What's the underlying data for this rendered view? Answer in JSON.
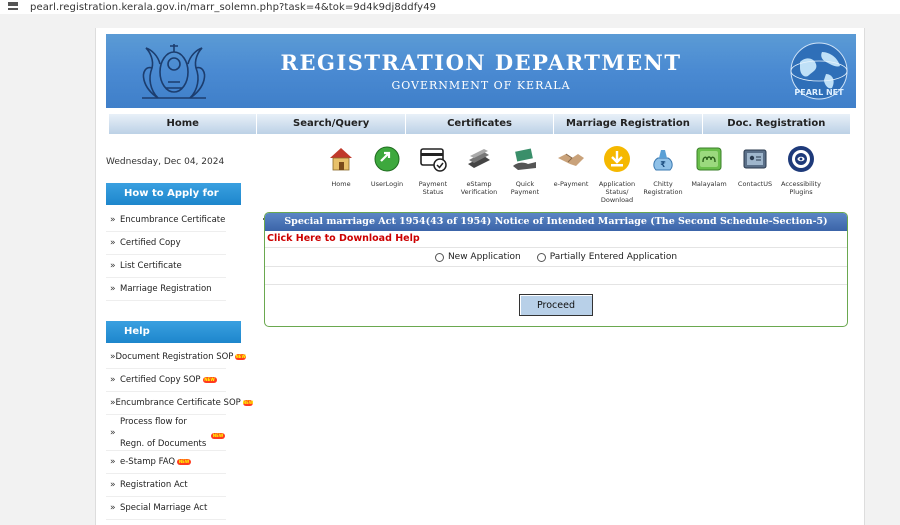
{
  "browser": {
    "url": "pearl.registration.kerala.gov.in/marr_solemn.php?task=4&tok=9d4k9dj8ddfy49"
  },
  "banner": {
    "title": "REGISTRATION DEPARTMENT",
    "subtitle": "GOVERNMENT OF KERALA",
    "globe_text": "PEARL NET"
  },
  "nav": [
    "Home",
    "Search/Query",
    "Certificates",
    "Marriage Registration",
    "Doc. Registration"
  ],
  "date": "Wednesday, Dec 04, 2024",
  "quick_icons": [
    {
      "label": "Home",
      "icon": "house-icon"
    },
    {
      "label": "UserLogin",
      "icon": "login-arrow-icon"
    },
    {
      "label": "Payment Status",
      "icon": "payment-status-icon"
    },
    {
      "label": "eStamp Verification",
      "icon": "estamp-icon"
    },
    {
      "label": "Quick Payment",
      "icon": "quick-payment-icon"
    },
    {
      "label": "e-Payment",
      "icon": "handshake-icon"
    },
    {
      "label": "Application Status/ Download",
      "icon": "download-icon"
    },
    {
      "label": "Chitty Registration",
      "icon": "chitty-icon"
    },
    {
      "label": "Malayalam",
      "icon": "malayalam-icon"
    },
    {
      "label": "ContactUS",
      "icon": "contact-icon"
    },
    {
      "label": "Accessibility Plugins",
      "icon": "accessibility-icon"
    }
  ],
  "sidebar": {
    "apply_heading": "How to Apply for",
    "apply_items": [
      "Encumbrance Certificate",
      "Certified Copy",
      "List Certificate",
      "Marriage Registration"
    ],
    "help_heading": "Help",
    "help_items": [
      {
        "label": "Document Registration SOP",
        "new": true
      },
      {
        "label": "Certified Copy SOP",
        "new": true
      },
      {
        "label": "Encumbrance Certificate SOP",
        "new": true
      },
      {
        "label": "Process flow for",
        "label2": "Regn. of Documents",
        "new": true
      },
      {
        "label": "e-Stamp FAQ",
        "new": true
      },
      {
        "label": "Registration Act",
        "new": false
      },
      {
        "label": "Special Marriage Act",
        "new": false
      }
    ],
    "new_badge": "NEW"
  },
  "form": {
    "title": "Special marriage Act 1954(43 of 1954) Notice of Intended Marriage (The Second Schedule-Section-5)",
    "download_link": "Click Here to Download Help",
    "options": [
      "New Application",
      "Partially Entered Application"
    ],
    "button": "Proceed"
  },
  "colors": {
    "banner_blue": "#4a8ad2",
    "sidebar_head": "#1d86cc",
    "link_red": "#cc0000",
    "form_border": "#6aa84f"
  }
}
